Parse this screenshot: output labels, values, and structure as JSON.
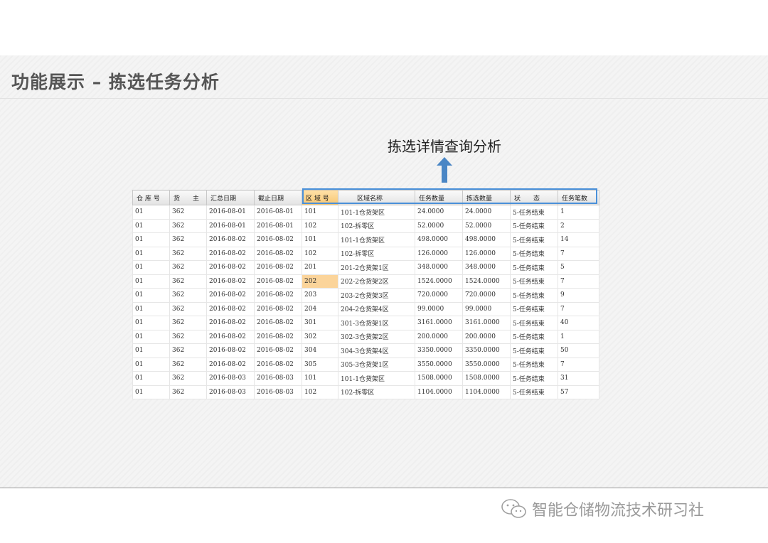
{
  "slide": {
    "title": "功能展示 – 拣选任务分析"
  },
  "annotation": {
    "text": "拣选详情查询分析",
    "arrow_color": "#4a86c5"
  },
  "grid": {
    "highlight_color": "#4a90d9",
    "selected_cell_color": "#fbd49a",
    "columns": [
      "仓 库 号",
      "货　　主",
      "汇总日期",
      "截止日期",
      "区 域 号",
      "区域名称",
      "任务数量",
      "拣选数量",
      "状　　态",
      "任务笔数"
    ],
    "rows": [
      [
        "01",
        "362",
        "2016-08-01",
        "2016-08-01",
        "101",
        "101-1仓货架区",
        "24.0000",
        "24.0000",
        "5-任务结束",
        "1"
      ],
      [
        "01",
        "362",
        "2016-08-01",
        "2016-08-01",
        "102",
        "102-拆零区",
        "52.0000",
        "52.0000",
        "5-任务结束",
        "2"
      ],
      [
        "01",
        "362",
        "2016-08-02",
        "2016-08-02",
        "101",
        "101-1仓货架区",
        "498.0000",
        "498.0000",
        "5-任务结束",
        "14"
      ],
      [
        "01",
        "362",
        "2016-08-02",
        "2016-08-02",
        "102",
        "102-拆零区",
        "126.0000",
        "126.0000",
        "5-任务结束",
        "7"
      ],
      [
        "01",
        "362",
        "2016-08-02",
        "2016-08-02",
        "201",
        "201-2仓货架1区",
        "348.0000",
        "348.0000",
        "5-任务结束",
        "5"
      ],
      [
        "01",
        "362",
        "2016-08-02",
        "2016-08-02",
        "202",
        "202-2仓货架2区",
        "1524.0000",
        "1524.0000",
        "5-任务结束",
        "7"
      ],
      [
        "01",
        "362",
        "2016-08-02",
        "2016-08-02",
        "203",
        "203-2仓货架3区",
        "720.0000",
        "720.0000",
        "5-任务结束",
        "9"
      ],
      [
        "01",
        "362",
        "2016-08-02",
        "2016-08-02",
        "204",
        "204-2仓货架4区",
        "99.0000",
        "99.0000",
        "5-任务结束",
        "7"
      ],
      [
        "01",
        "362",
        "2016-08-02",
        "2016-08-02",
        "301",
        "301-3仓货架1区",
        "3161.0000",
        "3161.0000",
        "5-任务结束",
        "40"
      ],
      [
        "01",
        "362",
        "2016-08-02",
        "2016-08-02",
        "302",
        "302-3仓货架2区",
        "200.0000",
        "200.0000",
        "5-任务结束",
        "1"
      ],
      [
        "01",
        "362",
        "2016-08-02",
        "2016-08-02",
        "304",
        "304-3仓货架4区",
        "3350.0000",
        "3350.0000",
        "5-任务结束",
        "50"
      ],
      [
        "01",
        "362",
        "2016-08-02",
        "2016-08-02",
        "305",
        "305-3仓货架1区",
        "3550.0000",
        "3550.0000",
        "5-任务结束",
        "7"
      ],
      [
        "01",
        "362",
        "2016-08-03",
        "2016-08-03",
        "101",
        "101-1仓货架区",
        "1508.0000",
        "1508.0000",
        "5-任务结束",
        "31"
      ],
      [
        "01",
        "362",
        "2016-08-03",
        "2016-08-03",
        "102",
        "102-拆零区",
        "1104.0000",
        "1104.0000",
        "5-任务结束",
        "57"
      ]
    ]
  },
  "footer": {
    "watermark": "智能仓储物流技术研习社",
    "wechat_icon": "wechat-icon"
  }
}
